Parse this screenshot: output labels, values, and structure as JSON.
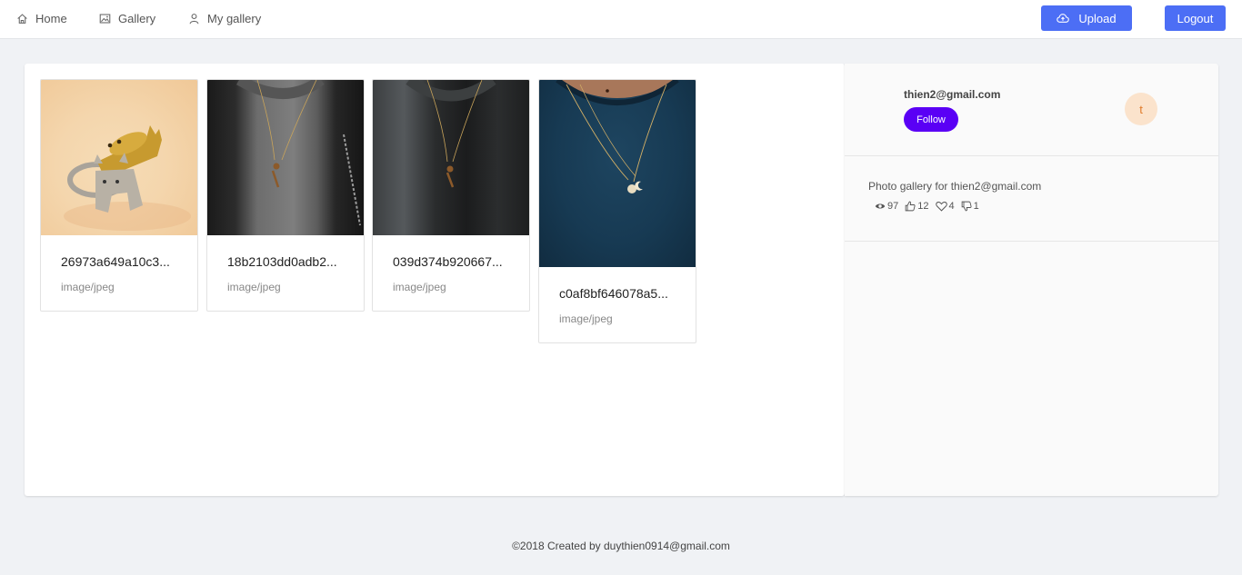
{
  "nav": {
    "home": {
      "label": "Home",
      "icon": "home-icon"
    },
    "gallery": {
      "label": "Gallery",
      "icon": "image-icon"
    },
    "my_gallery": {
      "label": "My gallery",
      "icon": "user-icon"
    }
  },
  "actions": {
    "upload": {
      "label": "Upload",
      "icon": "cloud-upload-icon"
    },
    "logout": {
      "label": "Logout"
    }
  },
  "cards": [
    {
      "title": "26973a649a10c3...",
      "type": "image/jpeg",
      "thumb": "cat-ring"
    },
    {
      "title": "18b2103dd0adb2...",
      "type": "image/jpeg",
      "thumb": "necklace-leather-jacket"
    },
    {
      "title": "039d374b920667...",
      "type": "image/jpeg",
      "thumb": "necklace-grey-coat"
    },
    {
      "title": "c0af8bf646078a5...",
      "type": "image/jpeg",
      "thumb": "necklace-navy-sweater"
    }
  ],
  "profile": {
    "username": "thien2@gmail.com",
    "follow_label": "Follow",
    "avatar_letter": "t",
    "description": "Photo gallery for thien2@gmail.com",
    "stats": {
      "views": "97",
      "likes": "12",
      "hearts": "4",
      "dislikes": "1"
    }
  },
  "footer": {
    "text": "©2018 Created by duythien0914@gmail.com"
  },
  "colors": {
    "accent": "#4c6ef5",
    "follow": "#5a00f5",
    "avatar_bg": "#fbe3cc",
    "avatar_fg": "#e07b2a"
  }
}
